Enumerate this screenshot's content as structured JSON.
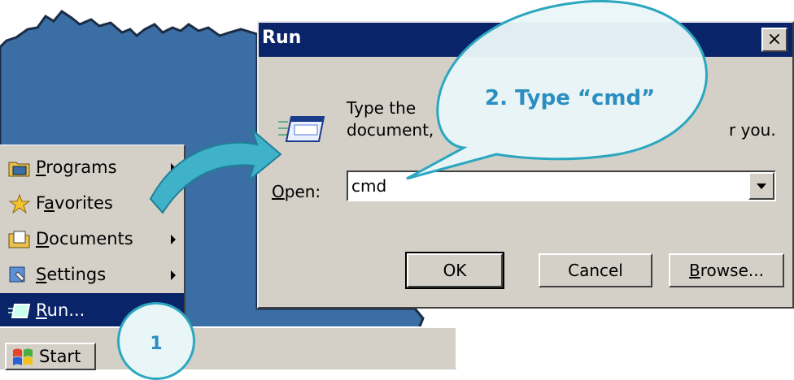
{
  "start_menu": {
    "items": [
      {
        "label": "Programs",
        "accel": "P",
        "rest": "rograms",
        "icon": "programs-folder-icon",
        "submenu": true
      },
      {
        "label": "Favorites",
        "accel": "a",
        "rest": "vorites",
        "pre": "F",
        "icon": "star-icon",
        "submenu": false
      },
      {
        "label": "Documents",
        "accel": "D",
        "rest": "ocuments",
        "icon": "documents-folder-icon",
        "submenu": true
      },
      {
        "label": "Settings",
        "accel": "S",
        "rest": "ettings",
        "icon": "settings-icon",
        "submenu": true
      },
      {
        "label": "Run...",
        "accel": "R",
        "rest": "un...",
        "icon": "run-icon",
        "submenu": false,
        "selected": true
      }
    ]
  },
  "taskbar": {
    "start_label": "Start"
  },
  "run_dialog": {
    "title": "Run",
    "close_glyph": "×",
    "description_line1": "Type the",
    "description_line1_tail": "",
    "description_line2": "document,",
    "description_line2_tail": "r you.",
    "open_label": "Open:",
    "open_value": "cmd",
    "buttons": {
      "ok": "OK",
      "cancel": "Cancel",
      "browse": "Browse..."
    }
  },
  "callouts": {
    "step1": "1",
    "step2": "2. Type “cmd”"
  },
  "colors": {
    "desktop": "#3a6ea5",
    "titlebar": "#0a246a",
    "face": "#d4d0c8",
    "accent": "#2aa7bf"
  }
}
